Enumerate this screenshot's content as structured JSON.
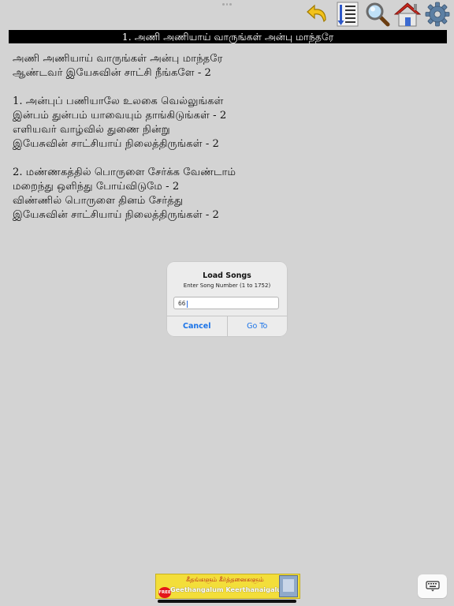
{
  "song": {
    "title": "1. அணி அணியாய் வாருங்கள் அன்பு மாந்தரே",
    "lines": [
      "அணி அணியாய் வாருங்கள் அன்பு மாந்தரே",
      "ஆண்டவர் இயேசுவின் சாட்சி நீங்களே - 2",
      "",
      "1. அன்புப் பணியாலே உலகை வெல்லுங்கள்",
      "இன்பம் துன்பம் யாவையும் தாங்கிடுங்கள் - 2",
      "எளியவர் வாழ்வில் துணை நின்று",
      "இயேசுவின் சாட்சியாய் நிலைத்திருங்கள் - 2",
      "",
      "2. மண்ணகத்தில் பொருளை சேர்க்க வேண்டாம்",
      "மறைந்து ஒளிந்து போய்விடுமே - 2",
      "விண்ணில் பொருளை தினம் சேர்த்து",
      "இயேசுவின் சாட்சியாய் நிலைத்திருங்கள் - 2"
    ]
  },
  "toolbar": {
    "icons": [
      "back-arrow-icon",
      "list-sort-icon",
      "magnifier-icon",
      "home-icon",
      "gear-icon"
    ]
  },
  "dialog": {
    "title": "Load Songs",
    "message": "Enter Song Number (1 to 1752)",
    "input_value": "66",
    "cancel_label": "Cancel",
    "go_label": "Go To"
  },
  "banner": {
    "line1": "கீதங்களும் கீர்த்தனைகளும்",
    "line2": "Geethangalum Keerthanaigalum",
    "badge": "FREE"
  },
  "colors": {
    "background": "#d3d3d3",
    "title_bar": "#000000",
    "dialog_button": "#1a73e8",
    "banner": "#f3de3a"
  }
}
